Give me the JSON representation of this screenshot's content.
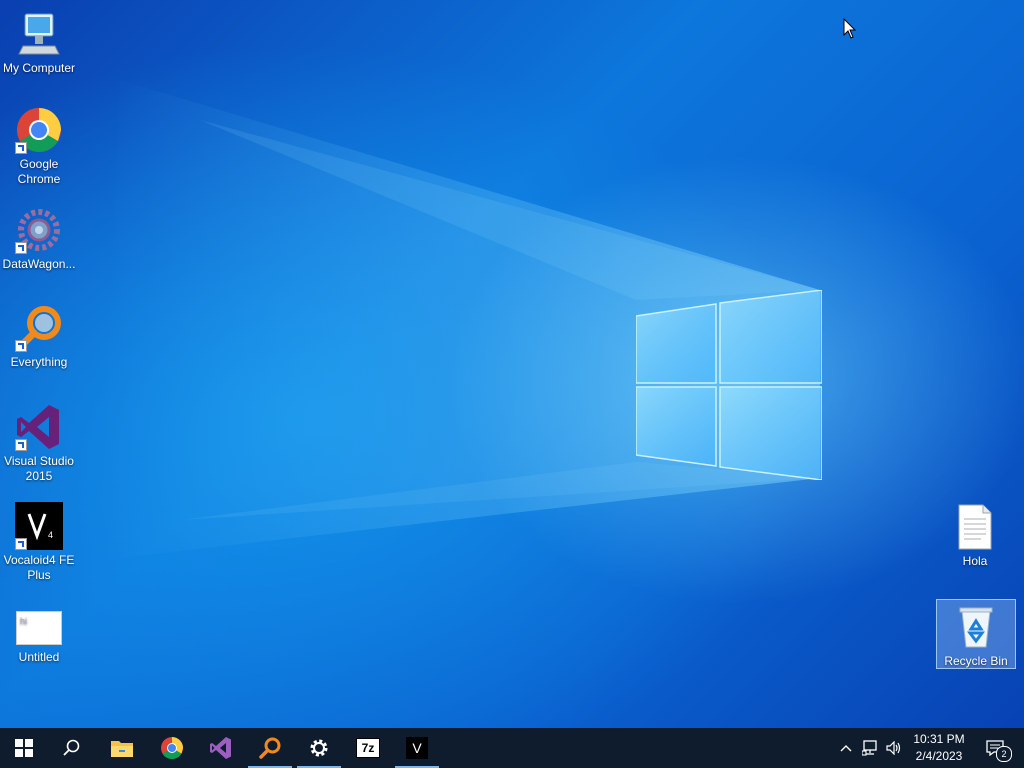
{
  "desktop_icons": {
    "my_computer": "My Computer",
    "chrome": "Google Chrome",
    "datawagon": "DataWagon...",
    "everything": "Everything",
    "visual_studio": "Visual Studio 2015",
    "vocaloid": "Vocaloid4 FE Plus",
    "untitled": "Untitled",
    "untitled_preview": "hi",
    "hola": "Hola",
    "recycle_bin": "Recycle Bin"
  },
  "taskbar": {
    "pinned": [
      "start-icon",
      "search-icon",
      "file-explorer-icon",
      "chrome-icon",
      "visual-studio-icon",
      "everything-icon",
      "settings-icon",
      "7zip-icon",
      "vocaloid-icon"
    ],
    "sevenzip_label": "7z",
    "vocaloid_label": "V"
  },
  "clock": {
    "time": "10:31 PM",
    "date": "2/4/2023"
  },
  "notifications": {
    "count": "2"
  },
  "colors": {
    "taskbar": "#0f1c2e",
    "accent": "#7fb6ea"
  }
}
